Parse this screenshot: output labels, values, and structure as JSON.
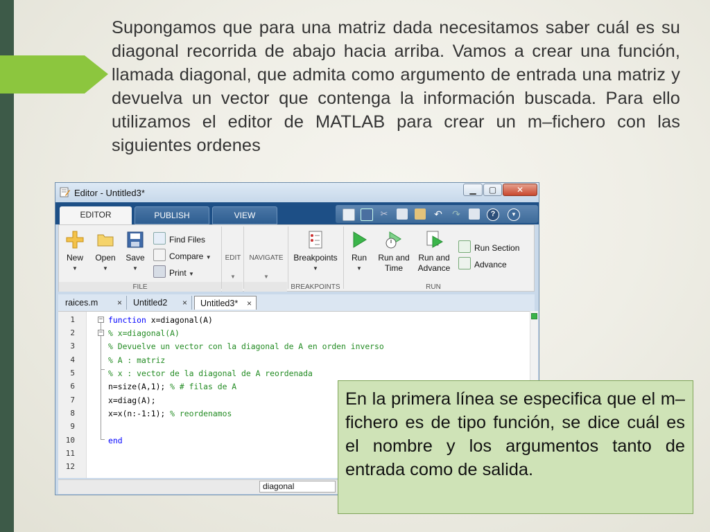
{
  "slide": {
    "paragraph": "Supongamos que para una matriz dada necesitamos saber cuál es su diagonal recorrida de abajo hacia arriba. Vamos a crear una función, llamada diagonal, que admita como argumento de entrada una matriz y devuelva un vector que contenga la información buscada. Para ello utilizamos el editor de MATLAB para crear un m–fichero con las siguientes ordenes",
    "callout": "En la primera línea se especifica que el m–fichero es de tipo función, se dice cuál es el nombre y los argumentos tanto de entrada como de salida.",
    "colors": {
      "sidebar": "#3d5a48",
      "arrow": "#8cc63e",
      "callout_bg": "#cfe3b7"
    }
  },
  "window": {
    "title": "Editor - Untitled3*",
    "controls": {
      "minimize": "▁",
      "maximize": "▢",
      "close": "✕"
    }
  },
  "ribbon": {
    "tabs": [
      {
        "label": "EDITOR",
        "active": true
      },
      {
        "label": "PUBLISH",
        "active": false
      },
      {
        "label": "VIEW",
        "active": false
      }
    ],
    "quick_access_icons": [
      "layout-icon",
      "save-icon",
      "cut-icon",
      "copy-icon",
      "paste-icon",
      "undo-icon",
      "redo-icon",
      "window-icon",
      "help-icon",
      "menu-icon"
    ],
    "file": {
      "label": "FILE",
      "new": "New",
      "open": "Open",
      "save": "Save",
      "find_files": "Find Files",
      "compare": "Compare",
      "print": "Print"
    },
    "edit": {
      "label": "EDIT"
    },
    "navigate": {
      "label": "NAVIGATE"
    },
    "breakpoints": {
      "label": "BREAKPOINTS",
      "button": "Breakpoints"
    },
    "run": {
      "label": "RUN",
      "run": "Run",
      "run_and_time": [
        "Run and",
        "Time"
      ],
      "run_and_advance": [
        "Run and",
        "Advance"
      ],
      "run_section": "Run Section",
      "advance": "Advance"
    }
  },
  "doc_tabs": [
    {
      "name": "raices.m",
      "close": "×"
    },
    {
      "name": "Untitled2",
      "close": "×"
    },
    {
      "name": "Untitled3*",
      "close": "×",
      "active": true
    }
  ],
  "code": {
    "line_numbers": [
      "1",
      "2",
      "3",
      "4",
      "5",
      "6",
      "7",
      "8",
      "9",
      "10",
      "11",
      "12"
    ],
    "lines": [
      {
        "kw": "function",
        "rest": " x=diagonal(A)"
      },
      {
        "cm": "% x=diagonal(A)"
      },
      {
        "cm": "% Devuelve un vector con la diagonal de A en orden inverso"
      },
      {
        "cm": "% A : matriz"
      },
      {
        "cm": "% x : vector de la diagonal de A reordenada"
      },
      {
        "tx": "n=size(A,1); ",
        "cm": "% # filas de A"
      },
      {
        "tx": "x=diag(A);"
      },
      {
        "tx": "x=x(n:-1:1); ",
        "cm": "% reordenamos"
      },
      {
        "tx": ""
      },
      {
        "kw": "end"
      },
      {
        "tx": ""
      },
      {
        "tx": ""
      }
    ]
  },
  "status": {
    "function_field": "diagonal"
  }
}
